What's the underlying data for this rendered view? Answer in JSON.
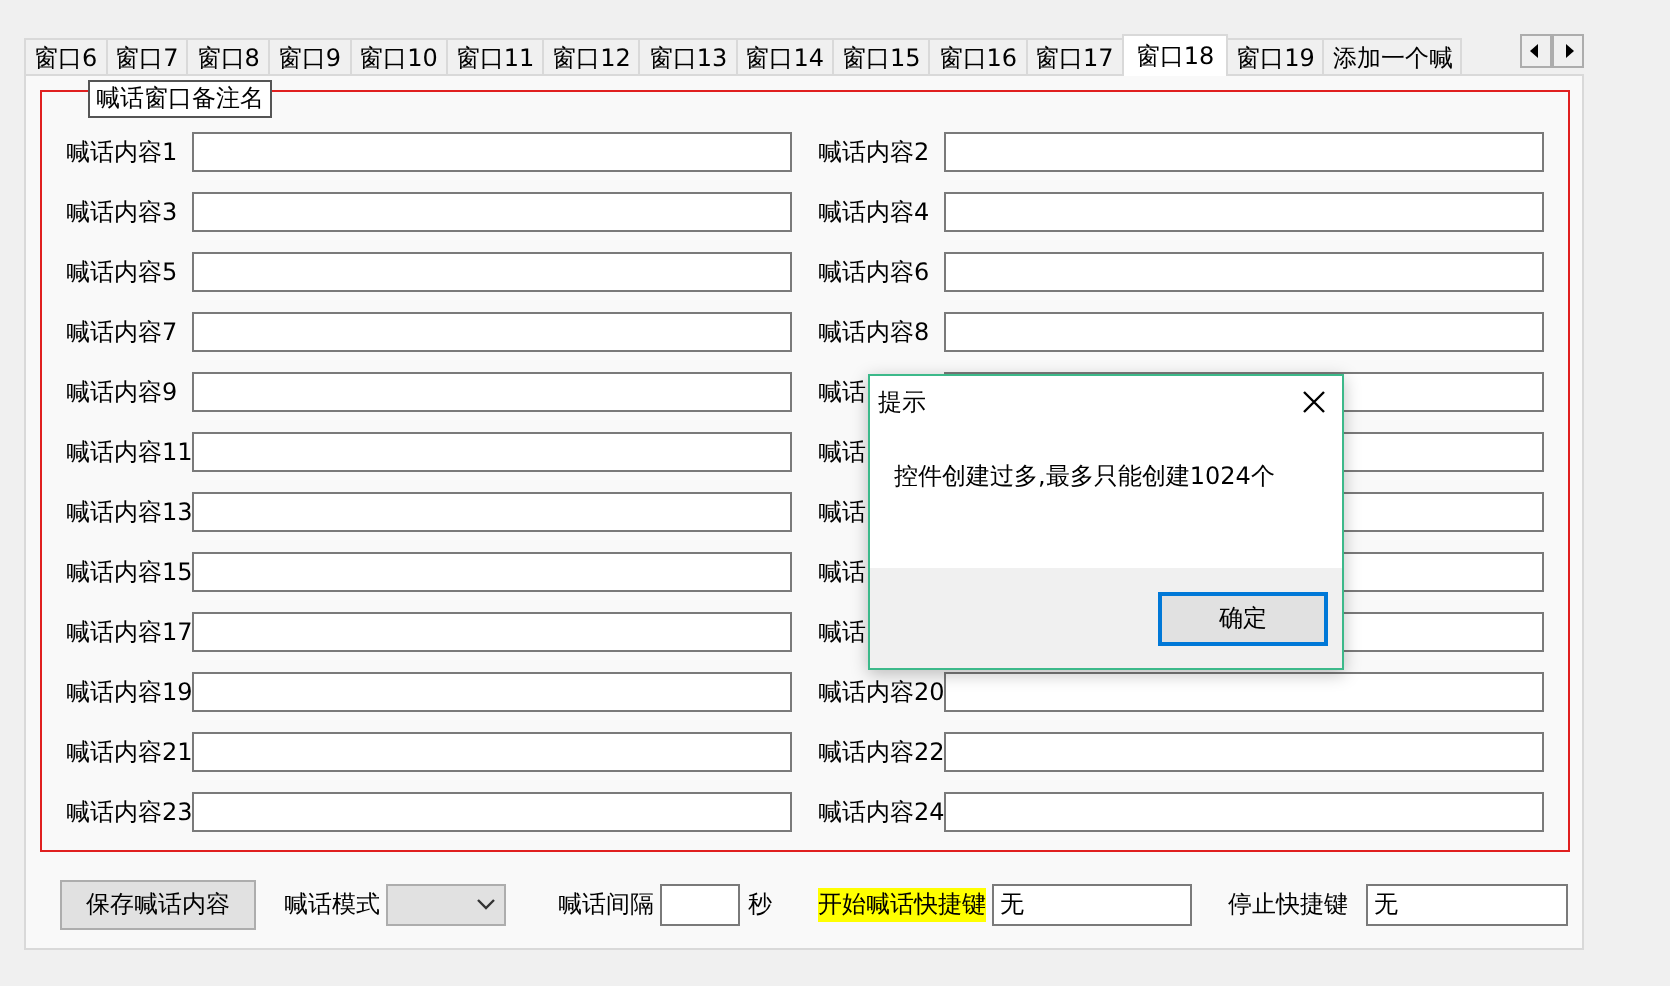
{
  "tabs": [
    {
      "label": "窗口6",
      "selected": false
    },
    {
      "label": "窗口7",
      "selected": false
    },
    {
      "label": "窗口8",
      "selected": false
    },
    {
      "label": "窗口9",
      "selected": false
    },
    {
      "label": "窗口10",
      "selected": false
    },
    {
      "label": "窗口11",
      "selected": false
    },
    {
      "label": "窗口12",
      "selected": false
    },
    {
      "label": "窗口13",
      "selected": false
    },
    {
      "label": "窗口14",
      "selected": false
    },
    {
      "label": "窗口15",
      "selected": false
    },
    {
      "label": "窗口16",
      "selected": false
    },
    {
      "label": "窗口17",
      "selected": false
    },
    {
      "label": "窗口18",
      "selected": true
    },
    {
      "label": "窗口19",
      "selected": false
    },
    {
      "label": "添加一个喊",
      "selected": false
    }
  ],
  "group": {
    "title": "喊话窗口备注名",
    "fields": [
      {
        "label": "喊话内容1"
      },
      {
        "label": "喊话内容2"
      },
      {
        "label": "喊话内容3"
      },
      {
        "label": "喊话内容4"
      },
      {
        "label": "喊话内容5"
      },
      {
        "label": "喊话内容6"
      },
      {
        "label": "喊话内容7"
      },
      {
        "label": "喊话内容8"
      },
      {
        "label": "喊话内容9"
      },
      {
        "label": "喊话"
      },
      {
        "label": "喊话内容11"
      },
      {
        "label": "喊话"
      },
      {
        "label": "喊话内容13"
      },
      {
        "label": "喊话"
      },
      {
        "label": "喊话内容15"
      },
      {
        "label": "喊话"
      },
      {
        "label": "喊话内容17"
      },
      {
        "label": "喊话"
      },
      {
        "label": "喊话内容19"
      },
      {
        "label": "喊话内容20"
      },
      {
        "label": "喊话内容21"
      },
      {
        "label": "喊话内容22"
      },
      {
        "label": "喊话内容23"
      },
      {
        "label": "喊话内容24"
      }
    ]
  },
  "bottom": {
    "save_button": "保存喊话内容",
    "mode_label": "喊话模式",
    "interval_label": "喊话间隔",
    "interval_unit": "秒",
    "start_hotkey": {
      "label": "开始喊话快捷键",
      "value": "无"
    },
    "stop_hotkey": {
      "label": "停止快捷键",
      "value": "无"
    }
  },
  "dialog": {
    "title": "提示",
    "message": "控件创建过多,最多只能创建1024个",
    "button": "确定"
  }
}
